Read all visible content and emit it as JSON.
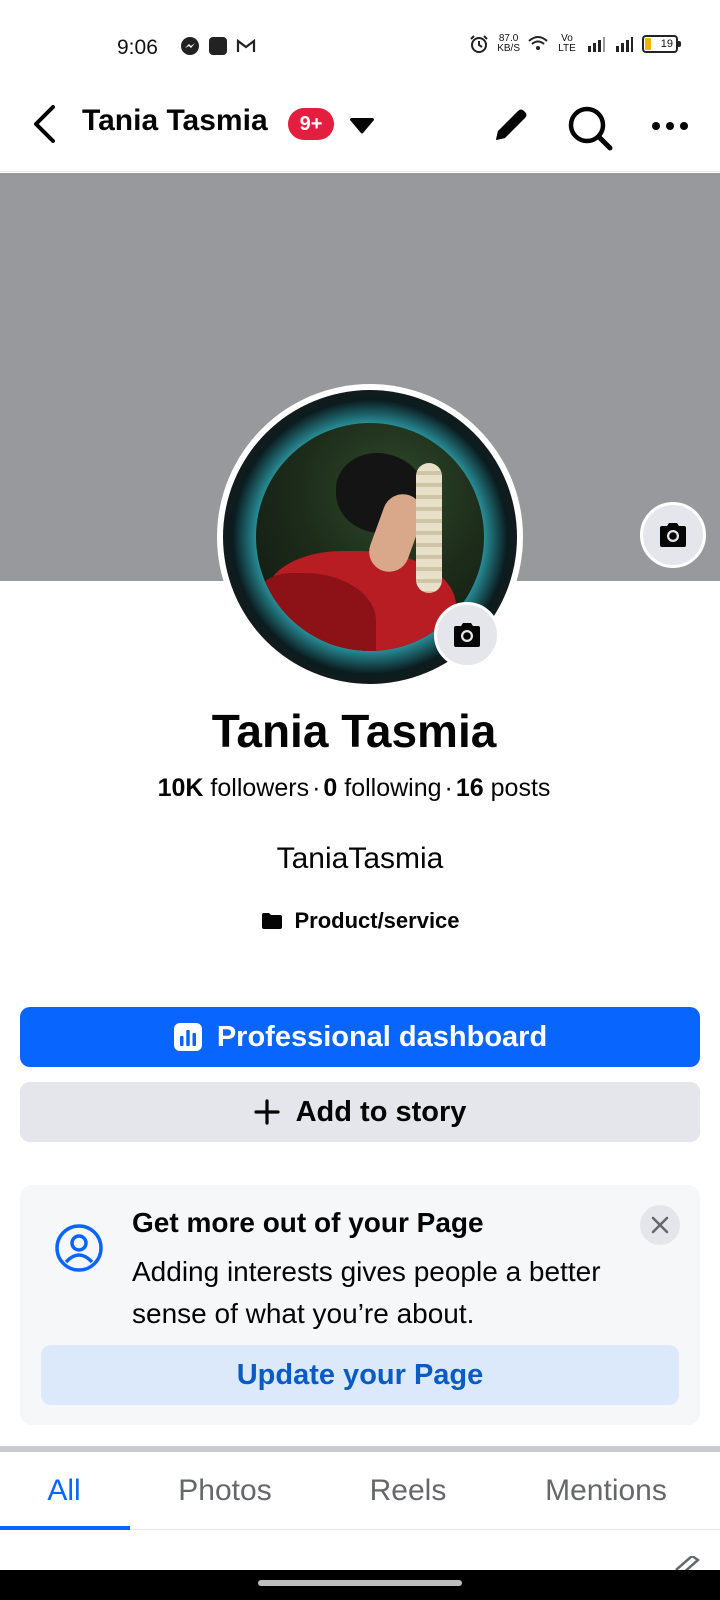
{
  "status_bar": {
    "time": "9:06",
    "left_icons": [
      "messenger-icon",
      "app-icon",
      "gmail-icon"
    ],
    "net_speed_value": "87.0",
    "net_speed_unit": "KB/S",
    "volte_label": "Vo LTE",
    "battery_level": "19"
  },
  "header": {
    "title": "Tania Tasmia",
    "badge": "9+",
    "icons": [
      "back-icon",
      "caret-down-icon",
      "pencil-icon",
      "search-icon",
      "more-icon"
    ]
  },
  "profile": {
    "name": "Tania Tasmia",
    "followers_count": "10K",
    "followers_label": "followers",
    "following_count": "0",
    "following_label": "following",
    "posts_count": "16",
    "posts_label": "posts",
    "username": "TaniaTasmia",
    "category": "Product/service"
  },
  "actions": {
    "professional_dashboard": "Professional dashboard",
    "add_to_story": "Add to story"
  },
  "promo_card": {
    "title": "Get more out of your Page",
    "body": "Adding interests gives people a better sense of what you’re about.",
    "button": "Update your Page"
  },
  "tabs": [
    {
      "label": "All",
      "active": true
    },
    {
      "label": "Photos",
      "active": false
    },
    {
      "label": "Reels",
      "active": false
    },
    {
      "label": "Mentions",
      "active": false
    }
  ],
  "colors": {
    "accent": "#0866ff",
    "badge": "#e41e3f",
    "cover": "#97999c"
  }
}
